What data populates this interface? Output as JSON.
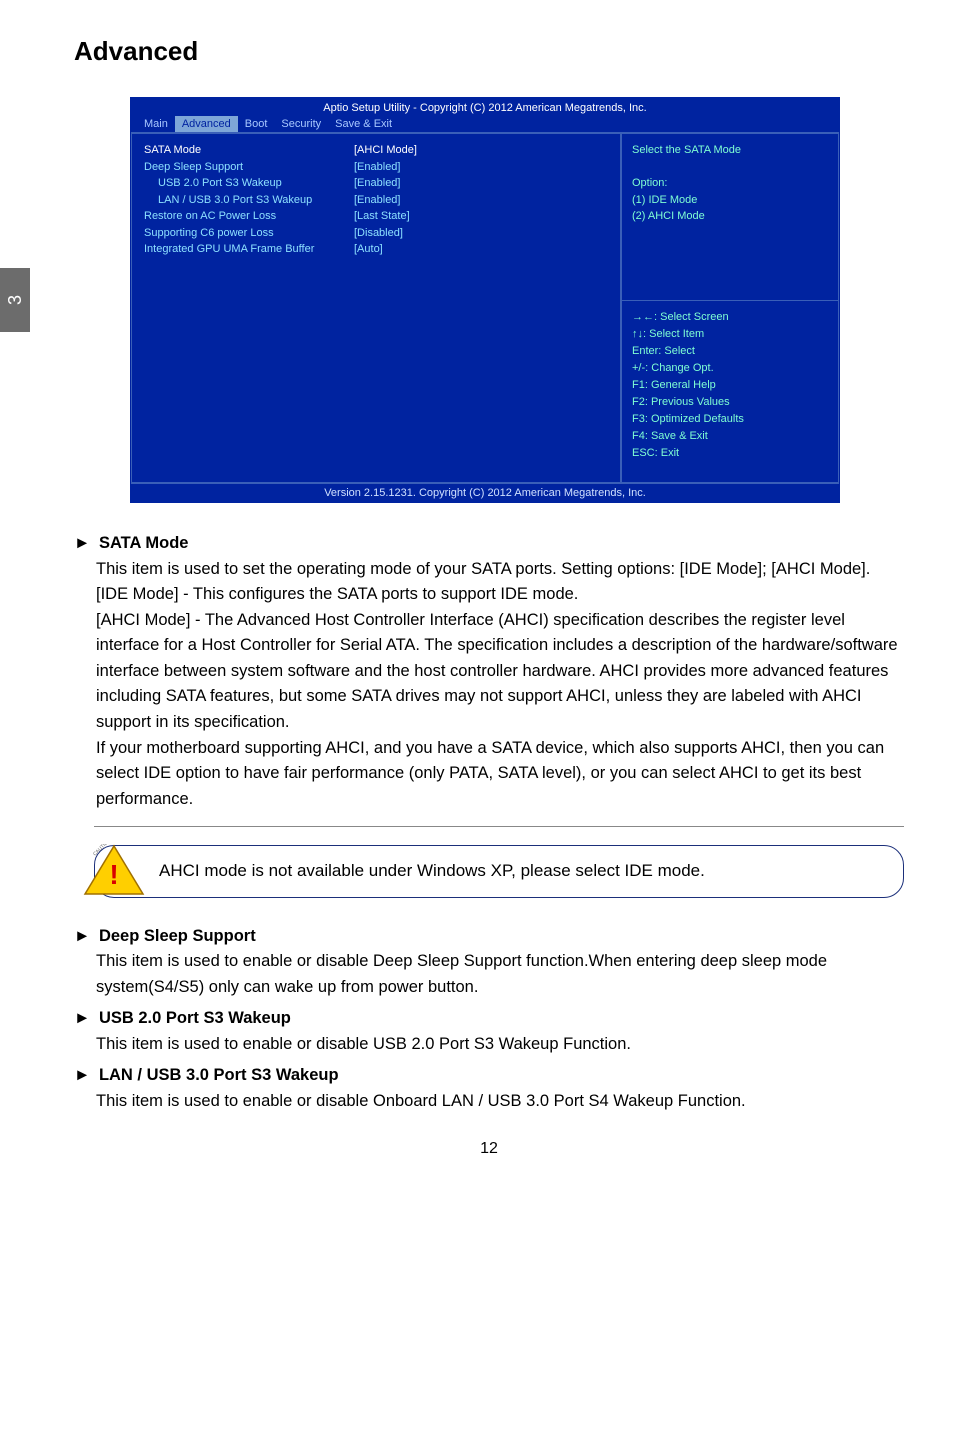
{
  "page_title": "Advanced",
  "side_tab": "3",
  "bios": {
    "header": "Aptio Setup Utility - Copyright (C) 2012 American Megatrends, Inc.",
    "tabs": [
      "Main",
      "Advanced",
      "Boot",
      "Security",
      "Save & Exit"
    ],
    "active_tab_index": 1,
    "rows": [
      {
        "label": "SATA Mode",
        "value": "[AHCI Mode]",
        "selected": true,
        "indent": false
      },
      {
        "label": "Deep Sleep Support",
        "value": "[Enabled]",
        "selected": false,
        "indent": false
      },
      {
        "label": "USB 2.0 Port S3 Wakeup",
        "value": "[Enabled]",
        "selected": false,
        "indent": true
      },
      {
        "label": "LAN / USB 3.0 Port S3 Wakeup",
        "value": "[Enabled]",
        "selected": false,
        "indent": true
      },
      {
        "label": "Restore on AC Power Loss",
        "value": "[Last State]",
        "selected": false,
        "indent": false
      },
      {
        "label": "Supporting C6 power Loss",
        "value": "[Disabled]",
        "selected": false,
        "indent": false
      },
      {
        "label": "Integrated GPU UMA Frame Buffer",
        "value": "[Auto]",
        "selected": false,
        "indent": false
      }
    ],
    "help_top_title": "Select the SATA Mode",
    "help_top_option_label": "Option:",
    "help_top_options": [
      "(1) IDE Mode",
      "(2) AHCI Mode"
    ],
    "help_bottom": [
      "→←: Select Screen",
      "↑↓: Select Item",
      "Enter: Select",
      "+/-: Change Opt.",
      "F1: General Help",
      "F2: Previous Values",
      "F3: Optimized Defaults",
      "F4: Save & Exit",
      "ESC: Exit"
    ],
    "footer": "Version 2.15.1231. Copyright (C) 2012 American Megatrends, Inc."
  },
  "items": {
    "sata_mode": {
      "head": "SATA Mode",
      "p1": "This item is used to set the operating mode of your SATA ports. Setting options: [IDE Mode]; [AHCI Mode].",
      "p2": "[IDE Mode] - This configures the SATA ports to support IDE mode.",
      "p3": "[AHCI Mode] - The Advanced Host Controller Interface (AHCI) specification describes the register level interface for a Host Controller for Serial ATA. The specification includes a description of the hardware/software interface between system software and the host controller hardware. AHCI provides more advanced features including SATA features, but some SATA drives may not support AHCI, unless they are labeled with AHCI support in its specification.",
      "p4": "If your motherboard supporting AHCI, and you have a SATA device, which also supports AHCI, then you can select IDE option to have fair performance (only PATA, SATA level), or you can select AHCI to get its best performance."
    },
    "caution_label": "CAUTION",
    "caution_text": "AHCI mode is not available under Windows XP,  please select IDE mode.",
    "deep_sleep": {
      "head": "Deep Sleep Support",
      "body": "This item is used to enable or disable Deep Sleep Support function.When entering deep sleep mode system(S4/S5) only can wake up from power button."
    },
    "usb20": {
      "head": "USB 2.0 Port S3 Wakeup",
      "body": "This item is used to enable or disable USB 2.0 Port S3 Wakeup Function."
    },
    "lan_usb30": {
      "head": "LAN / USB 3.0 Port S3 Wakeup",
      "body": "This item is used to enable or disable Onboard LAN / USB 3.0 Port S4 Wakeup Function."
    }
  },
  "page_number": "12"
}
